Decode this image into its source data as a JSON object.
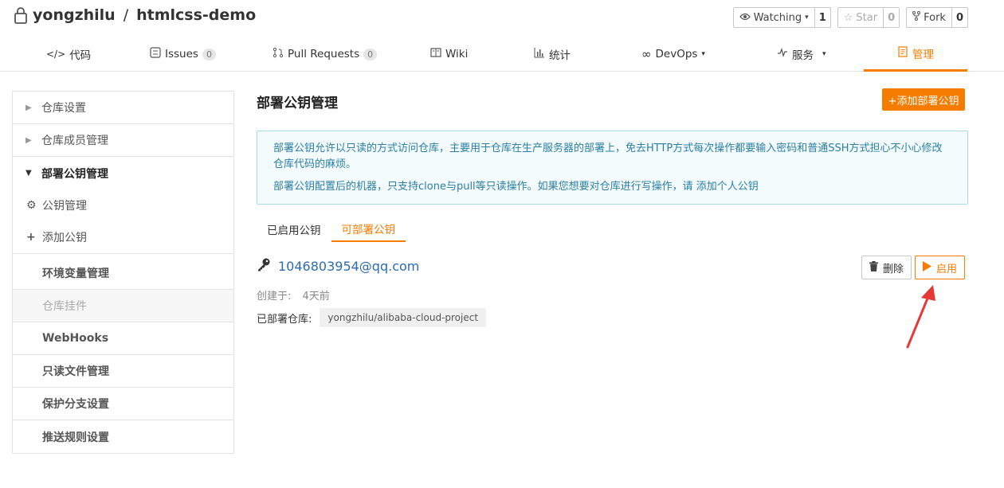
{
  "repo": {
    "owner": "yongzhilu",
    "separator": "/",
    "name": "htmlcss-demo"
  },
  "actions": {
    "watching": {
      "label": "Watching",
      "count": "1"
    },
    "star": {
      "label": "Star",
      "count": "0"
    },
    "fork": {
      "label": "Fork",
      "count": "0"
    }
  },
  "tabs": [
    {
      "label": "代码"
    },
    {
      "label": "Issues",
      "badge": "0"
    },
    {
      "label": "Pull Requests",
      "badge": "0"
    },
    {
      "label": "Wiki"
    },
    {
      "label": "统计"
    },
    {
      "label": "DevOps"
    },
    {
      "label": "服务"
    },
    {
      "label": "管理"
    }
  ],
  "sidebar": {
    "items": [
      {
        "label": "仓库设置"
      },
      {
        "label": "仓库成员管理"
      },
      {
        "label": "部署公钥管理"
      },
      {
        "label": "公钥管理"
      },
      {
        "label": "添加公钥"
      },
      {
        "label": "环境变量管理"
      },
      {
        "label": "仓库挂件"
      },
      {
        "label": "WebHooks"
      },
      {
        "label": "只读文件管理"
      },
      {
        "label": "保护分支设置"
      },
      {
        "label": "推送规则设置"
      }
    ]
  },
  "main": {
    "title": "部署公钥管理",
    "add_button": "+添加部署公钥",
    "info": {
      "line1": "部署公钥允许以只读的方式访问仓库，主要用于仓库在生产服务器的部署上，免去HTTP方式每次操作都要输入密码和普通SSH方式担心不小心修改仓库代码的麻烦。",
      "line2": "部署公钥配置后的机器，只支持clone与pull等只读操作。如果您想要对仓库进行写操作，请 添加个人公钥"
    },
    "sub_tabs": [
      {
        "label": "已启用公钥"
      },
      {
        "label": "可部署公钥"
      }
    ],
    "key": {
      "email": "1046803954@qq.com",
      "created_label": "创建于:",
      "created_value": "4天前",
      "deployed_label": "已部署仓库:",
      "deployed_repo": "yongzhilu/alibaba-cloud-project",
      "delete_label": "删除",
      "enable_label": "启用"
    }
  },
  "colors": {
    "accent": "#f57c00",
    "info_text": "#2b7fa5",
    "link": "#2b6cb0",
    "annotation_arrow": "#e53935"
  }
}
